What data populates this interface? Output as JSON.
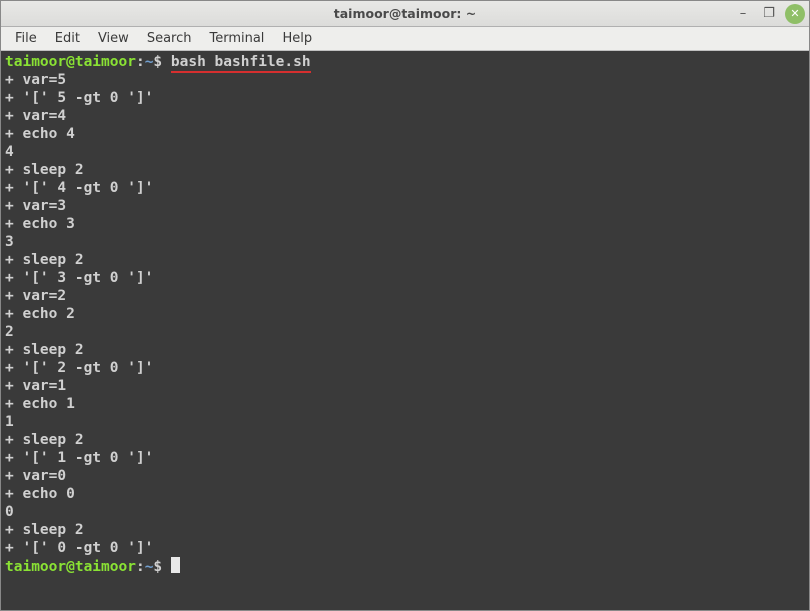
{
  "titlebar": {
    "title": "taimoor@taimoor: ~"
  },
  "window_controls": {
    "minimize": "–",
    "maximize": "❐",
    "close": "✕"
  },
  "menubar": {
    "items": [
      {
        "label": "File"
      },
      {
        "label": "Edit"
      },
      {
        "label": "View"
      },
      {
        "label": "Search"
      },
      {
        "label": "Terminal"
      },
      {
        "label": "Help"
      }
    ]
  },
  "prompt": {
    "user_host": "taimoor@taimoor",
    "colon": ":",
    "path": "~",
    "dollar": "$"
  },
  "command": {
    "text": "bash bashfile.sh"
  },
  "output": {
    "lines": [
      "+ var=5",
      "+ '[' 5 -gt 0 ']'",
      "+ var=4",
      "+ echo 4",
      "4",
      "+ sleep 2",
      "+ '[' 4 -gt 0 ']'",
      "+ var=3",
      "+ echo 3",
      "3",
      "+ sleep 2",
      "+ '[' 3 -gt 0 ']'",
      "+ var=2",
      "+ echo 2",
      "2",
      "+ sleep 2",
      "+ '[' 2 -gt 0 ']'",
      "+ var=1",
      "+ echo 1",
      "1",
      "+ sleep 2",
      "+ '[' 1 -gt 0 ']'",
      "+ var=0",
      "+ echo 0",
      "0",
      "+ sleep 2",
      "+ '[' 0 -gt 0 ']'"
    ]
  }
}
